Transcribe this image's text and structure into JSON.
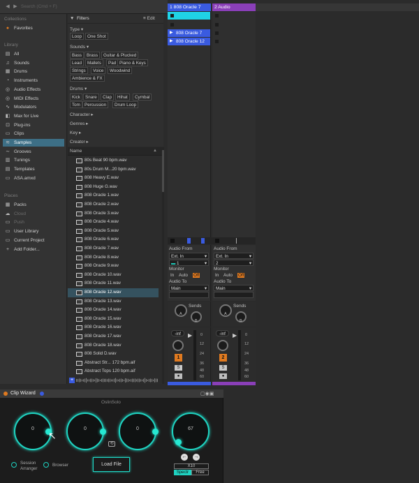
{
  "topbar": {
    "search_placeholder": "Search (Cmd + F)",
    "back_icon": "◀",
    "fwd_icon": "▶"
  },
  "sidebar": {
    "collections_label": "Collections",
    "favorites_label": "Favorites",
    "library_label": "Library",
    "library_items": [
      {
        "label": "All",
        "icon": "▤"
      },
      {
        "label": "Sounds",
        "icon": "♫"
      },
      {
        "label": "Drums",
        "icon": "▦"
      },
      {
        "label": "Instruments",
        "icon": "◔"
      },
      {
        "label": "Audio Effects",
        "icon": "◎"
      },
      {
        "label": "MIDI Effects",
        "icon": "◎"
      },
      {
        "label": "Modulators",
        "icon": "∿"
      },
      {
        "label": "Max for Live",
        "icon": "◧"
      },
      {
        "label": "Plug-ins",
        "icon": "⊡"
      },
      {
        "label": "Clips",
        "icon": "▭"
      },
      {
        "label": "Samples",
        "icon": "≋"
      },
      {
        "label": "Grooves",
        "icon": "∼"
      },
      {
        "label": "Tunings",
        "icon": "▥"
      },
      {
        "label": "Templates",
        "icon": "▤"
      },
      {
        "label": "ASA.amxd",
        "icon": "▭"
      }
    ],
    "places_label": "Places",
    "places_items": [
      {
        "label": "Packs",
        "icon": "▦"
      },
      {
        "label": "Cloud",
        "icon": "☁"
      },
      {
        "label": "Push",
        "icon": "▭"
      },
      {
        "label": "User Library",
        "icon": "▭"
      },
      {
        "label": "Current Project",
        "icon": "▭"
      },
      {
        "label": "Add Folder...",
        "icon": "+"
      }
    ]
  },
  "filters": {
    "title": "Filters",
    "edit_label": "Edit",
    "type_label": "Type",
    "type_tags": [
      "Loop",
      "One Shot"
    ],
    "sounds_label": "Sounds",
    "sounds_tags": [
      "Bass",
      "Brass",
      "Guitar & Plucked",
      "Lead",
      "Mallets",
      "Pad",
      "Piano & Keys",
      "Strings",
      "Voice",
      "Woodwind",
      "Ambience & FX"
    ],
    "drums_label": "Drums",
    "drums_tags": [
      "Kick",
      "Snare",
      "Clap",
      "Hihat",
      "Cymbal",
      "Tom",
      "Percussion",
      "Drum Loop"
    ],
    "character_label": "Character",
    "genres_label": "Genres",
    "key_label": "Key",
    "creator_label": "Creator"
  },
  "filelist": {
    "header": "Name",
    "files": [
      "80s Beat 90 bpm.wav",
      "80s Drum M...20 bpm.wav",
      "808 Heavy E.wav",
      "808 Huge G.wav",
      "808 Oracle 1.wav",
      "808 Oracle 2.wav",
      "808 Oracle 3.wav",
      "808 Oracle 4.wav",
      "808 Oracle 5.wav",
      "808 Oracle 6.wav",
      "808 Oracle 7.wav",
      "808 Oracle 8.wav",
      "808 Oracle 9.wav",
      "808 Oracle 10.wav",
      "808 Oracle 11.wav",
      "808 Oracle 12.wav",
      "808 Oracle 13.wav",
      "808 Oracle 14.wav",
      "808 Oracle 15.wav",
      "808 Oracle 16.wav",
      "808 Oracle 17.wav",
      "808 Oracle 18.wav",
      "808 Solid D.wav",
      "Abstract Str... 172 bpm.aif",
      "Abstract Tops 120 bpm.aif"
    ],
    "selected": "808 Oracle 12.wav"
  },
  "session": {
    "track1": {
      "name": "1 808 Oracle 7",
      "color": "#3a5be0",
      "clips": [
        "808 Oracle 7",
        "808 Oracle 12"
      ],
      "audio_from_label": "Audio From",
      "audio_from": "Ext. In",
      "input_channel": "1",
      "monitor_label": "Monitor",
      "monitor_in": "In",
      "monitor_auto": "Auto",
      "monitor_off": "Off",
      "audio_to_label": "Audio To",
      "audio_to": "Main",
      "sends_label": "Sends",
      "send_a": "A",
      "send_b": "B",
      "volume": "-inf",
      "track_num": "1",
      "solo": "S"
    },
    "track2": {
      "name": "2 Audio",
      "color": "#8a3fb8",
      "audio_from_label": "Audio From",
      "audio_from": "Ext. In",
      "input_channel": "2",
      "monitor_label": "Monitor",
      "monitor_in": "In",
      "monitor_auto": "Auto",
      "monitor_off": "Off",
      "audio_to_label": "Audio To",
      "audio_to": "Main",
      "sends_label": "Sends",
      "send_a": "A",
      "send_b": "B",
      "volume": "-inf",
      "track_num": "2",
      "solo": "S"
    },
    "meter_scale": [
      "0",
      "12",
      "24",
      "36",
      "48",
      "60"
    ]
  },
  "device": {
    "title": "Clip Wizard",
    "brand": "OslinSolo",
    "knobs": [
      {
        "value": "0",
        "level": 0.0
      },
      {
        "value": "0",
        "level": 0.0
      },
      {
        "value": "0",
        "level": 0.0
      },
      {
        "value": "67",
        "level": 0.67
      }
    ],
    "session_arranger_label": "Session\nArranger",
    "browser_label": "Browser",
    "load_file_label": "Load File",
    "multiplier": "X10",
    "mode_on": "Spectr",
    "mode_free": "Free"
  },
  "colors": {
    "accent": "#1fd3c1",
    "selected": "#3d6f86",
    "orange": "#e07a20"
  }
}
